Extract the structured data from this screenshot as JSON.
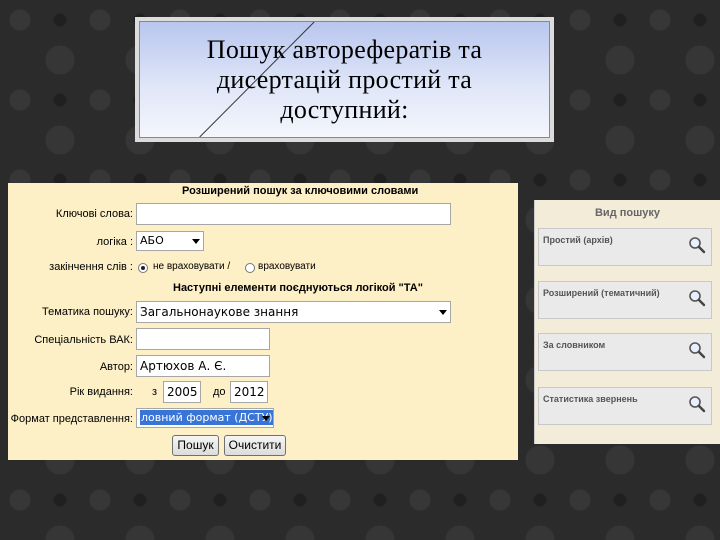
{
  "slide": {
    "title_line1": "Пошук авторефератів та",
    "title_line2": "дисертацій простий та",
    "title_line3": "доступний:"
  },
  "form": {
    "heading": "Розширений пошук за ключовими словами",
    "keywords_label": "Ключові слова:",
    "keywords_value": "",
    "logic_label": "логіка :",
    "logic_value": "АБО",
    "endings_label": "закінчення слів :",
    "endings_option1": "не враховувати /",
    "endings_option2": "враховувати",
    "endings_selected": "не враховувати",
    "subheading": "Наступні елементи поєднуються логікой \"ТА\"",
    "topic_label": "Тематика пошуку:",
    "topic_value": "Загальнонаукове знання",
    "specialty_label": "Спеціальність ВАК:",
    "specialty_value": "",
    "author_label": "Автор:",
    "author_value": "Артюхов А. Є.",
    "year_label": "Рік видання:",
    "year_from_label": "з",
    "year_from_value": "2005",
    "year_to_label": "до",
    "year_to_value": "2012",
    "format_label": "Формат представлення:",
    "format_value": "ловний формат (ДСТУ)",
    "search_button": "Пошук",
    "clear_button": "Очистити"
  },
  "sidebar": {
    "title": "Вид пошуку",
    "items": [
      {
        "label": "Простий (архів)",
        "icon": "magnifier-icon"
      },
      {
        "label": "Розширений (тематичний)",
        "icon": "magnifier-icon"
      },
      {
        "label": "За словником",
        "icon": "magnifier-icon"
      },
      {
        "label": "Статистика звернень",
        "icon": "magnifier-icon"
      }
    ]
  },
  "colors": {
    "form_bg": "#fdefc6",
    "selected_highlight": "#3875d7",
    "sidebar_bg": "#f2ecd9"
  }
}
